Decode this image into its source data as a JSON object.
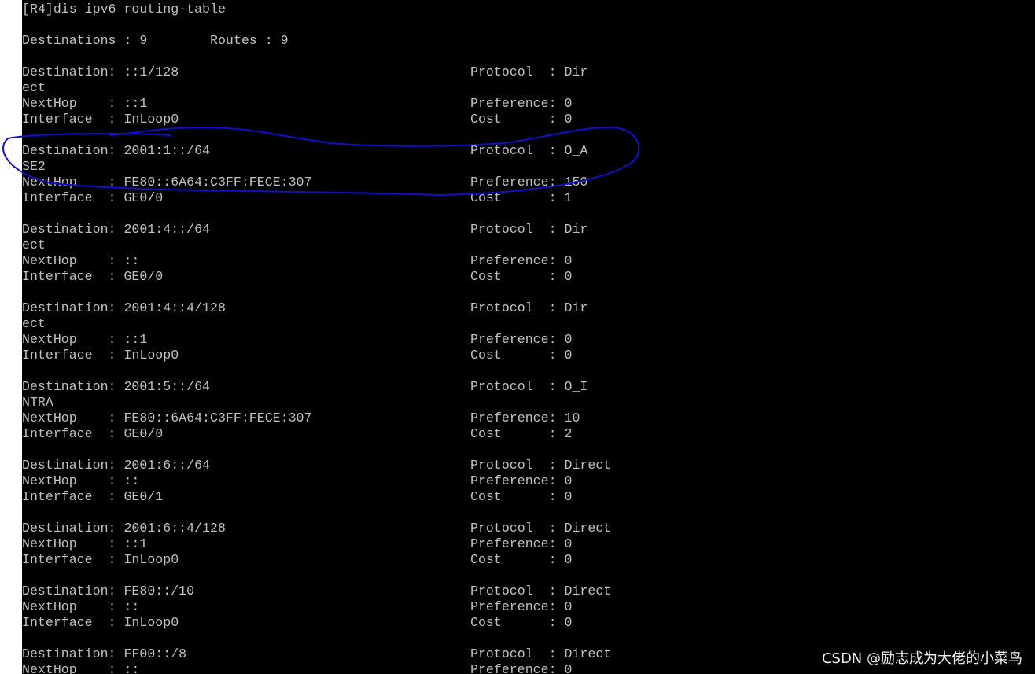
{
  "terminal": {
    "lines": [
      [
        "[R4]dis ipv6 routing-table",
        ""
      ],
      [
        "",
        ""
      ],
      [
        "Destinations : 9        Routes : 9",
        ""
      ],
      [
        "",
        ""
      ],
      [
        "Destination: ::1/128",
        "Protocol  : Dir"
      ],
      [
        "ect",
        ""
      ],
      [
        "NextHop    : ::1",
        "Preference: 0"
      ],
      [
        "Interface  : InLoop0",
        "Cost      : 0"
      ],
      [
        "",
        ""
      ],
      [
        "Destination: 2001:1::/64",
        "Protocol  : O_A"
      ],
      [
        "SE2",
        ""
      ],
      [
        "NextHop    : FE80::6A64:C3FF:FECE:307",
        "Preference: 150"
      ],
      [
        "Interface  : GE0/0",
        "Cost      : 1"
      ],
      [
        "",
        ""
      ],
      [
        "Destination: 2001:4::/64",
        "Protocol  : Dir"
      ],
      [
        "ect",
        ""
      ],
      [
        "NextHop    : ::",
        "Preference: 0"
      ],
      [
        "Interface  : GE0/0",
        "Cost      : 0"
      ],
      [
        "",
        ""
      ],
      [
        "Destination: 2001:4::4/128",
        "Protocol  : Dir"
      ],
      [
        "ect",
        ""
      ],
      [
        "NextHop    : ::1",
        "Preference: 0"
      ],
      [
        "Interface  : InLoop0",
        "Cost      : 0"
      ],
      [
        "",
        ""
      ],
      [
        "Destination: 2001:5::/64",
        "Protocol  : O_I"
      ],
      [
        "NTRA",
        ""
      ],
      [
        "NextHop    : FE80::6A64:C3FF:FECE:307",
        "Preference: 10"
      ],
      [
        "Interface  : GE0/0",
        "Cost      : 2"
      ],
      [
        "",
        ""
      ],
      [
        "Destination: 2001:6::/64",
        "Protocol  : Direct"
      ],
      [
        "NextHop    : ::",
        "Preference: 0"
      ],
      [
        "Interface  : GE0/1",
        "Cost      : 0"
      ],
      [
        "",
        ""
      ],
      [
        "Destination: 2001:6::4/128",
        "Protocol  : Direct"
      ],
      [
        "NextHop    : ::1",
        "Preference: 0"
      ],
      [
        "Interface  : InLoop0",
        "Cost      : 0"
      ],
      [
        "",
        ""
      ],
      [
        "Destination: FE80::/10",
        "Protocol  : Direct"
      ],
      [
        "NextHop    : ::",
        "Preference: 0"
      ],
      [
        "Interface  : InLoop0",
        "Cost      : 0"
      ],
      [
        "",
        ""
      ],
      [
        "Destination: FF00::/8",
        "Protocol  : Direct"
      ],
      [
        "NextHop    : ::",
        "Preference: 0"
      ]
    ]
  },
  "annotation": {
    "color": "#1010c8"
  },
  "watermark": {
    "text": "CSDN @励志成为大佬的小菜鸟"
  }
}
